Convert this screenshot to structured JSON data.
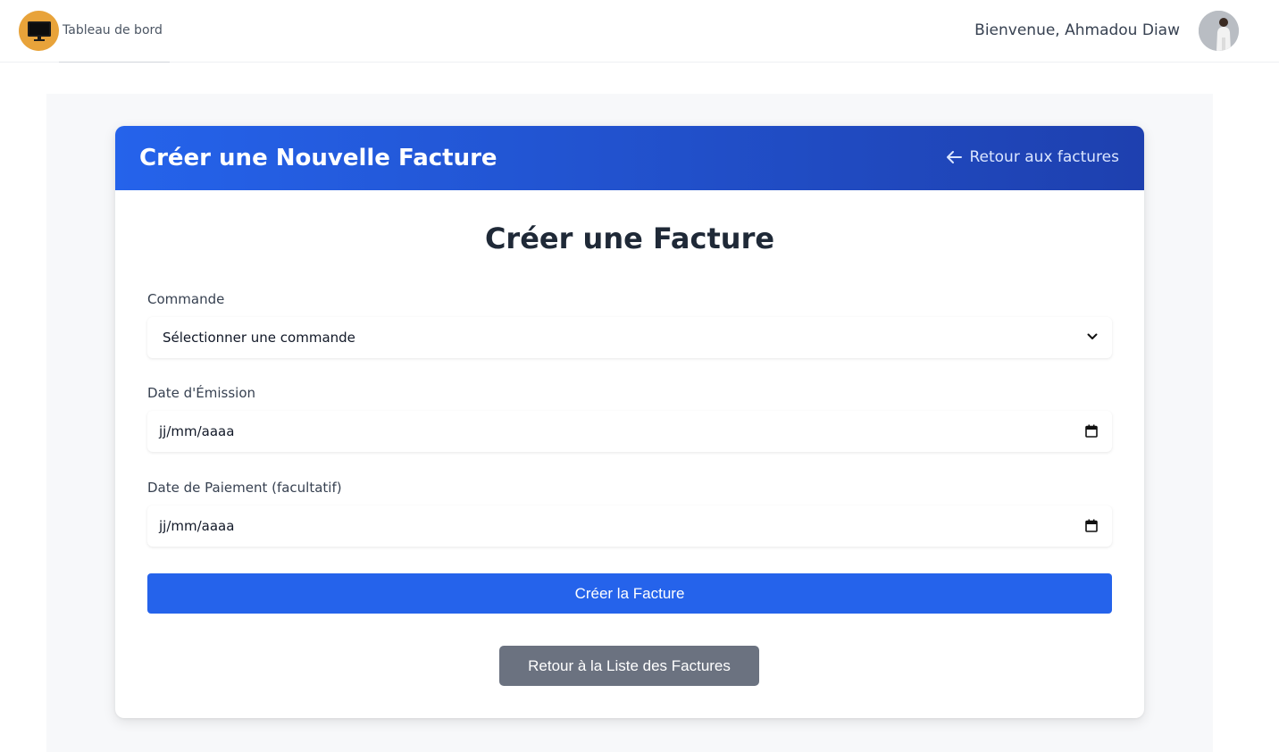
{
  "nav": {
    "brand_label": "Tableau de bord",
    "welcome_text": "Bienvenue, Ahmadou Diaw",
    "logo_color": "#e8a33a"
  },
  "card": {
    "header_title": "Créer une Nouvelle Facture",
    "back_link_label": "Retour aux factures",
    "form_title": "Créer une Facture"
  },
  "form": {
    "commande": {
      "label": "Commande",
      "selected": "Sélectionner une commande"
    },
    "date_emission": {
      "label": "Date d'Émission",
      "placeholder": "jj/mm/aaaa"
    },
    "date_paiement": {
      "label": "Date de Paiement (facultatif)",
      "placeholder": "jj/mm/aaaa"
    },
    "submit_label": "Créer la Facture",
    "back_button_label": "Retour à la Liste des Factures"
  },
  "colors": {
    "primary": "#2563eb",
    "header_gradient_end": "#1e40af",
    "secondary_button": "#6b7280"
  },
  "icons": {
    "logo": "computer-monitor-icon",
    "back_arrow": "arrow-left-icon",
    "select_chevron": "chevron-down-icon",
    "calendar": "calendar-icon",
    "avatar": "user-avatar"
  }
}
